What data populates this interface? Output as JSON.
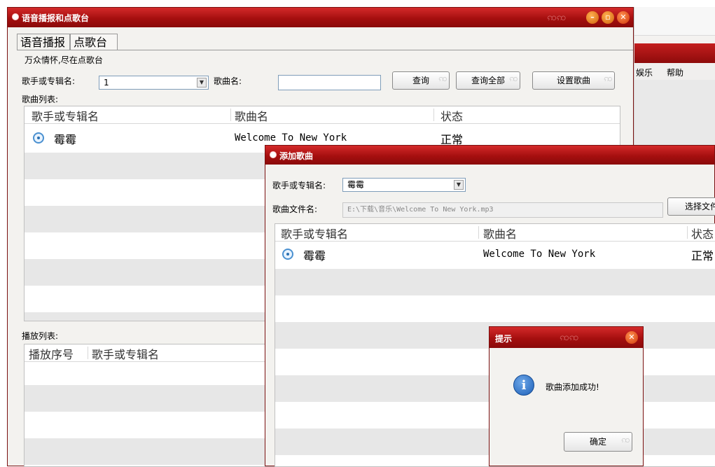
{
  "background_window": {
    "menu": [
      "娱乐",
      "帮助"
    ]
  },
  "main_window": {
    "title": "语音播报和点歌台",
    "tabs": [
      "语音播报",
      "点歌台"
    ],
    "group_title": "万众情怀,尽在点歌台",
    "singer_label": "歌手或专辑名:",
    "singer_value": "1",
    "song_label": "歌曲名:",
    "song_value": "",
    "buttons": {
      "query": "查询",
      "query_all": "查询全部",
      "set_song": "设置歌曲"
    },
    "song_list_label": "歌曲列表:",
    "song_list": {
      "columns": [
        "歌手或专辑名",
        "歌曲名",
        "状态"
      ],
      "rows": [
        {
          "singer": "霉霉",
          "song": "Welcome To New York",
          "status": "正常"
        }
      ]
    },
    "play_list_label": "播放列表:",
    "play_list": {
      "columns": [
        "播放序号",
        "歌手或专辑名"
      ]
    }
  },
  "add_song_dialog": {
    "title": "添加歌曲",
    "singer_label": "歌手或专辑名:",
    "singer_value": "霉霉",
    "file_label": "歌曲文件名:",
    "file_value": "E:\\下载\\音乐\\Welcome To New York.mp3",
    "choose_button": "选择文件",
    "list": {
      "columns": [
        "歌手或专辑名",
        "歌曲名",
        "状态"
      ],
      "rows": [
        {
          "singer": "霉霉",
          "song": "Welcome To New York",
          "status": "正常"
        }
      ]
    }
  },
  "tip_dialog": {
    "title": "提示",
    "message": "歌曲添加成功!",
    "ok": "确定"
  },
  "colors": {
    "titlebar": "#a50f0f",
    "minimize": "#e07a1a",
    "maximize": "#e07a1a",
    "close": "#e04a1a"
  }
}
